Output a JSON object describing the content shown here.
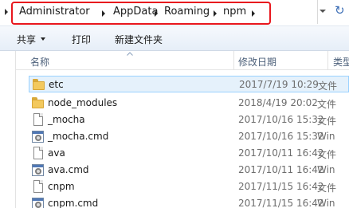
{
  "address": {
    "crumbs": [
      "Administrator",
      "AppData",
      "Roaming",
      "npm"
    ],
    "highlight_color": "#e8171e"
  },
  "toolbar": {
    "share_label": "共享",
    "print_label": "打印",
    "new_folder_label": "新建文件夹"
  },
  "columns": {
    "name": "名称",
    "modified": "修改日期",
    "type": "类型"
  },
  "files": [
    {
      "name": "etc",
      "modified": "2017/7/19 10:29",
      "type": "文件",
      "icon": "folder-icon",
      "selected": true
    },
    {
      "name": "node_modules",
      "modified": "2018/4/19 20:02",
      "type": "文件",
      "icon": "folder-icon",
      "selected": false
    },
    {
      "name": "_mocha",
      "modified": "2017/10/16 15:32",
      "type": "文件",
      "icon": "file-icon",
      "selected": false
    },
    {
      "name": "_mocha.cmd",
      "modified": "2017/10/16 15:32",
      "type": "Win",
      "icon": "cmd-icon",
      "selected": false
    },
    {
      "name": "ava",
      "modified": "2017/10/11 16:42",
      "type": "文件",
      "icon": "file-icon",
      "selected": false
    },
    {
      "name": "ava.cmd",
      "modified": "2017/10/11 16:42",
      "type": "Win",
      "icon": "cmd-icon",
      "selected": false
    },
    {
      "name": "cnpm",
      "modified": "2017/11/15 16:42",
      "type": "文件",
      "icon": "file-icon",
      "selected": false
    },
    {
      "name": "cnpm.cmd",
      "modified": "2017/11/15 16:42",
      "type": "Win",
      "icon": "cmd-icon",
      "selected": false
    }
  ]
}
